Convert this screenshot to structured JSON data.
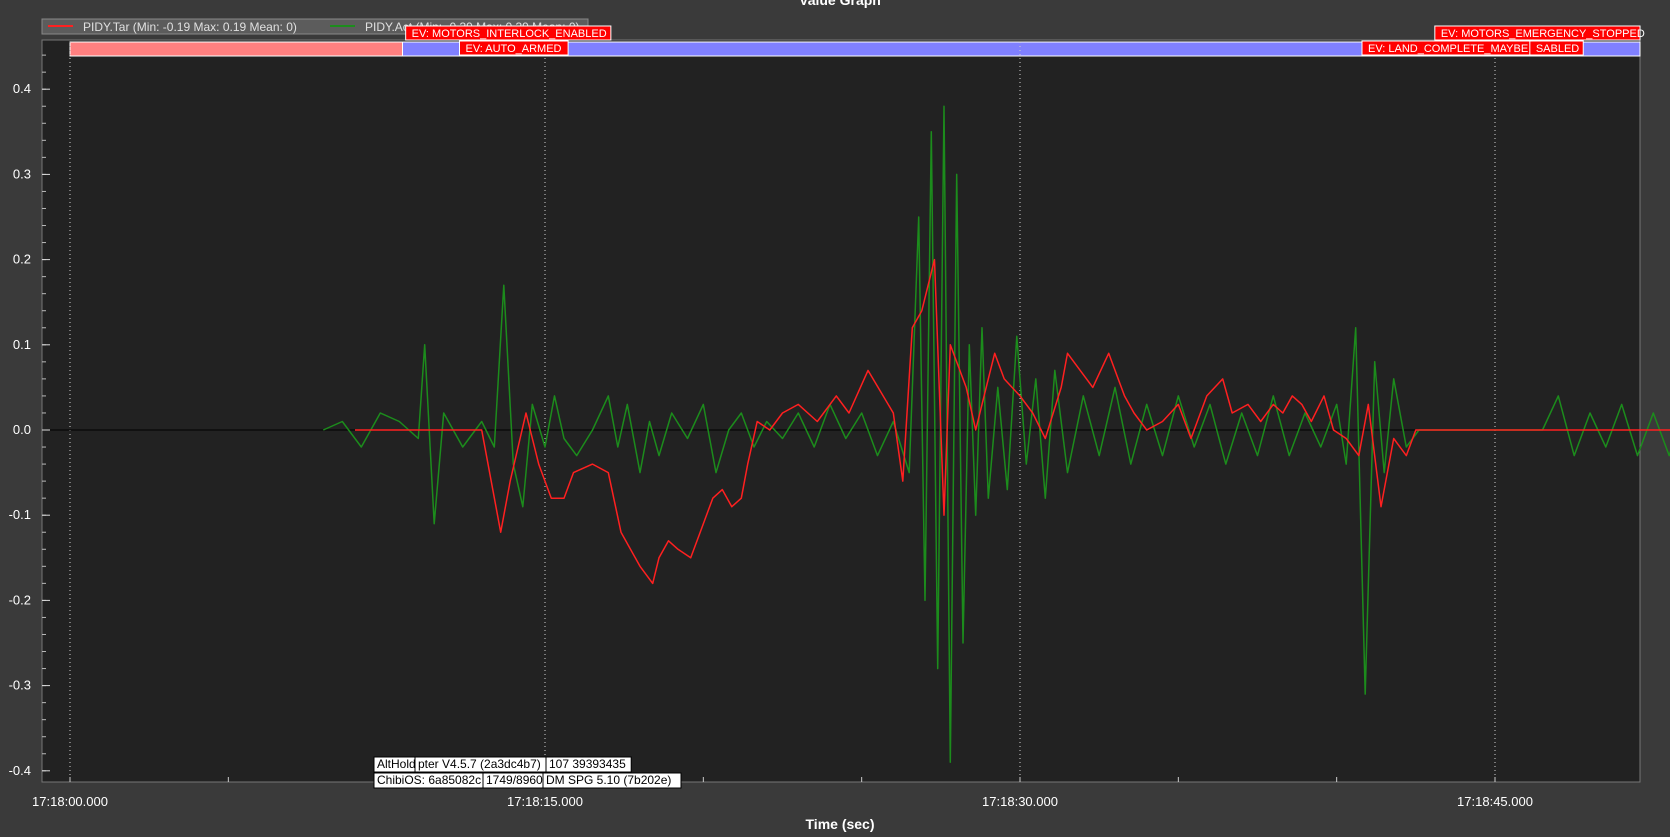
{
  "chart_data": {
    "type": "line",
    "title": "Value Graph",
    "xlabel": "Time (sec)",
    "ylabel": "",
    "xlim": [
      0,
      54
    ],
    "ylim": [
      -0.42,
      0.45
    ],
    "xticks": [
      {
        "value": 0,
        "label": "17:18:00.000"
      },
      {
        "value": 15,
        "label": "17:18:15.000"
      },
      {
        "value": 30,
        "label": "17:18:30.000"
      },
      {
        "value": 45,
        "label": "17:18:45.000"
      }
    ],
    "yticks": [
      {
        "value": 0.4,
        "label": "0.4"
      },
      {
        "value": 0.3,
        "label": "0.3"
      },
      {
        "value": 0.2,
        "label": "0.2"
      },
      {
        "value": 0.1,
        "label": "0.1"
      },
      {
        "value": 0.0,
        "label": "0.0"
      },
      {
        "value": -0.1,
        "label": "-0.1"
      },
      {
        "value": -0.2,
        "label": "-0.2"
      },
      {
        "value": -0.3,
        "label": "-0.3"
      },
      {
        "value": -0.4,
        "label": "-0.4"
      }
    ],
    "grid": true,
    "legend_position": "top-left",
    "series": [
      {
        "name": "PIDY.Tar",
        "legend": "PIDY.Tar  (Min: -0.19 Max: 0.19 Mean: 0)",
        "color": "#ff2020",
        "x": [
          9,
          10,
          13,
          13.6,
          13.9,
          14.4,
          14.8,
          15.2,
          15.6,
          15.9,
          16.5,
          17,
          17.4,
          18,
          18.4,
          18.6,
          18.9,
          19.2,
          19.6,
          19.9,
          20.3,
          20.6,
          20.9,
          21.2,
          21.4,
          21.7,
          22.1,
          22.5,
          23,
          23.6,
          24.2,
          24.6,
          25.2,
          26,
          26.3,
          26.6,
          26.9,
          27.3,
          27.6,
          27.8,
          28.3,
          28.6,
          29,
          29.2,
          29.5,
          30,
          30.4,
          30.8,
          31.3,
          31.5,
          31.9,
          32.3,
          32.8,
          33.3,
          33.6,
          34,
          34.5,
          35,
          35.4,
          35.9,
          36.4,
          36.7,
          37.2,
          37.6,
          38,
          38.3,
          38.6,
          38.9,
          39.2,
          39.6,
          39.9,
          40.3,
          40.7,
          41,
          41.4,
          41.8,
          42.2,
          42.5,
          42.8,
          44,
          46,
          48,
          50,
          52,
          54
        ],
        "y": [
          0,
          0,
          0,
          -0.12,
          -0.06,
          0.02,
          -0.04,
          -0.08,
          -0.08,
          -0.05,
          -0.04,
          -0.05,
          -0.12,
          -0.16,
          -0.18,
          -0.15,
          -0.13,
          -0.14,
          -0.15,
          -0.12,
          -0.08,
          -0.07,
          -0.09,
          -0.08,
          -0.04,
          0.01,
          0.0,
          0.02,
          0.03,
          0.01,
          0.04,
          0.02,
          0.07,
          0.02,
          -0.06,
          0.12,
          0.14,
          0.2,
          -0.1,
          0.1,
          0.05,
          0.0,
          0.06,
          0.09,
          0.06,
          0.04,
          0.02,
          -0.01,
          0.05,
          0.09,
          0.07,
          0.05,
          0.09,
          0.04,
          0.02,
          0.0,
          0.01,
          0.03,
          -0.01,
          0.04,
          0.06,
          0.02,
          0.03,
          0.01,
          0.03,
          0.02,
          0.04,
          0.03,
          0.01,
          0.04,
          0.0,
          -0.01,
          -0.03,
          0.03,
          -0.09,
          -0.01,
          -0.03,
          0.0,
          0.0,
          0,
          0,
          0,
          0,
          0,
          0
        ]
      },
      {
        "name": "PIDY.Act",
        "legend": "PIDY.Act (Min: -0.39 Max: 0.39 Mean: 0)",
        "color": "#1c8c1c",
        "x": [
          8,
          8.6,
          9.2,
          9.8,
          10.4,
          11,
          11.2,
          11.5,
          11.8,
          12.4,
          13,
          13.4,
          13.7,
          14,
          14.3,
          14.6,
          15,
          15.3,
          15.6,
          16,
          16.5,
          17,
          17.3,
          17.6,
          18,
          18.3,
          18.6,
          19,
          19.5,
          20,
          20.4,
          20.8,
          21.2,
          21.6,
          22,
          22.5,
          23,
          23.5,
          24,
          24.5,
          25,
          25.5,
          26,
          26.5,
          26.8,
          27,
          27.2,
          27.4,
          27.6,
          27.8,
          28,
          28.2,
          28.4,
          28.6,
          28.8,
          29,
          29.3,
          29.6,
          29.9,
          30.2,
          30.5,
          30.8,
          31.1,
          31.5,
          32,
          32.5,
          33,
          33.5,
          34,
          34.5,
          35,
          35.5,
          36,
          36.5,
          37,
          37.5,
          38,
          38.5,
          39,
          39.5,
          40,
          40.3,
          40.6,
          40.9,
          41.2,
          41.5,
          41.8,
          42.2,
          42.6,
          43,
          44,
          45.5,
          46.5,
          47,
          47.5,
          48,
          48.5,
          49,
          49.5,
          50,
          50.5,
          51,
          51.5,
          52,
          52.5,
          53,
          53.3,
          53.6,
          54
        ],
        "y": [
          0,
          0.01,
          -0.02,
          0.02,
          0.01,
          -0.01,
          0.1,
          -0.11,
          0.02,
          -0.02,
          0.01,
          -0.02,
          0.17,
          -0.04,
          -0.09,
          0.03,
          -0.02,
          0.04,
          -0.01,
          -0.03,
          0.0,
          0.04,
          -0.02,
          0.03,
          -0.05,
          0.01,
          -0.03,
          0.02,
          -0.01,
          0.03,
          -0.05,
          0.0,
          0.02,
          -0.02,
          0.01,
          -0.01,
          0.02,
          -0.02,
          0.03,
          -0.01,
          0.02,
          -0.03,
          0.01,
          -0.05,
          0.25,
          -0.2,
          0.35,
          -0.28,
          0.38,
          -0.39,
          0.3,
          -0.25,
          0.1,
          -0.1,
          0.12,
          -0.08,
          0.05,
          -0.07,
          0.11,
          -0.04,
          0.06,
          -0.08,
          0.07,
          -0.05,
          0.04,
          -0.03,
          0.05,
          -0.04,
          0.03,
          -0.03,
          0.04,
          -0.02,
          0.03,
          -0.04,
          0.02,
          -0.03,
          0.04,
          -0.03,
          0.02,
          -0.02,
          0.03,
          -0.04,
          0.12,
          -0.31,
          0.08,
          -0.05,
          0.06,
          -0.02,
          0.0,
          0.0,
          0.0,
          0.0,
          0.0,
          0.04,
          -0.03,
          0.02,
          -0.02,
          0.03,
          -0.03,
          0.02,
          -0.03,
          0.03,
          -0.02,
          0.03,
          -0.03,
          0.02,
          0.08,
          -0.07,
          0.0
        ]
      }
    ],
    "mode_bands": [
      {
        "start": 0,
        "end": 10.5,
        "color": "#ff8080"
      },
      {
        "start": 10.5,
        "end": 54,
        "color": "#8080ff"
      }
    ],
    "event_labels": [
      {
        "text": "EV: MOTORS_INTERLOCK_ENABLED",
        "time": 10.6,
        "row": 0
      },
      {
        "text": "EV: AUTO_ARMED",
        "time": 12.3,
        "row": 1
      },
      {
        "text": "EV: MOTORS_EMERGENCY_STOPPED",
        "time": 43.1,
        "row": 0
      },
      {
        "text": "EV: LAND_COMPLETE_MAYBE",
        "time": 40.8,
        "row": 1
      },
      {
        "text": "SABLED",
        "time": 46.1,
        "row": 1
      }
    ],
    "info_labels": [
      {
        "text": "AltHold",
        "row": 0,
        "col": 0
      },
      {
        "text": "pter V4.5.7 (2a3dc4b7)",
        "row": 0,
        "col": 1
      },
      {
        "text": "107 39393435",
        "row": 0,
        "col": 2
      },
      {
        "text": "ChibiOS: 6a85082c",
        "row": 1,
        "col": 0
      },
      {
        "text": "1749/8960",
        "row": 1,
        "col": 1
      },
      {
        "text": "DM SPG 5.10 (7b202e)",
        "row": 1,
        "col": 2
      }
    ]
  }
}
